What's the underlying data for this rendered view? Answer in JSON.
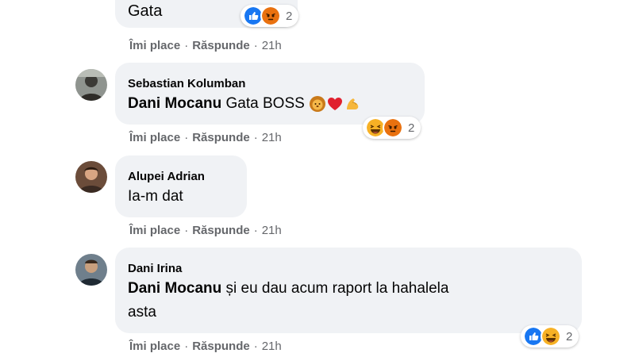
{
  "comments": [
    {
      "text": "Gata",
      "reactions": {
        "icons": [
          "like-icon",
          "angry-icon"
        ],
        "count": "2"
      },
      "actions": {
        "like": "Îmi place",
        "reply": "Răspunde",
        "time": "21h"
      }
    },
    {
      "author": "Sebastian Kolumban",
      "mention": "Dani Mocanu",
      "text": "Gata BOSS",
      "emojis": [
        "lion-emoji",
        "red-heart-emoji",
        "flexed-biceps-emoji"
      ],
      "reactions": {
        "icons": [
          "haha-icon",
          "angry-icon"
        ],
        "count": "2"
      },
      "actions": {
        "like": "Îmi place",
        "reply": "Răspunde",
        "time": "21h"
      }
    },
    {
      "author": "Alupei Adrian",
      "text": "Ia-m dat",
      "actions": {
        "like": "Îmi place",
        "reply": "Răspunde",
        "time": "21h"
      }
    },
    {
      "author": "Dani Irina",
      "mention": "Dani Mocanu",
      "text_line1": "și eu dau acum raport la hahalela",
      "text_line2": "asta",
      "reactions": {
        "icons": [
          "like-icon",
          "haha-icon"
        ],
        "count": "2"
      },
      "actions": {
        "like": "Îmi place",
        "reply": "Răspunde",
        "time": "21h"
      }
    }
  ],
  "separator": "·",
  "colors": {
    "bubble": "#f0f2f5",
    "meta": "#65676b",
    "like": "#1877f2",
    "angry": "#e9710f",
    "haha": "#f7b125"
  }
}
